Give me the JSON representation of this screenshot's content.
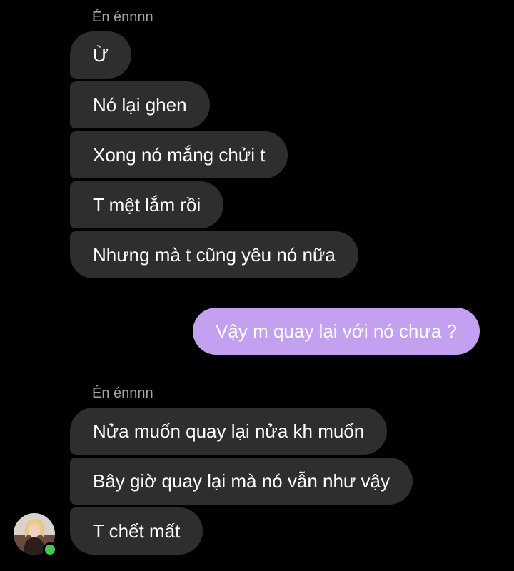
{
  "thread": {
    "group1": {
      "sender": "Én énnnn",
      "messages": [
        "Ừ",
        "Nó lại ghen",
        "Xong nó mắng chửi t",
        "T mệt lắm rồi",
        "Nhưng mà t cũng yêu nó nữa"
      ]
    },
    "outgoing": {
      "messages": [
        "Vậy m quay lại với nó chưa ?"
      ]
    },
    "group2": {
      "sender": "Én énnnn",
      "messages": [
        "Nửa muốn quay lại nửa kh muốn",
        "Bây giờ quay lại mà nó vẫn như vậy",
        "T chết mất"
      ]
    }
  },
  "colors": {
    "background": "#000000",
    "incoming_bubble": "#2e2e2e",
    "outgoing_bubble": "#c3a1f0",
    "sender_name": "#a7a7a7",
    "online_indicator": "#44c94b"
  },
  "icons": {
    "avatar": "profile-photo",
    "presence": "online-dot"
  }
}
